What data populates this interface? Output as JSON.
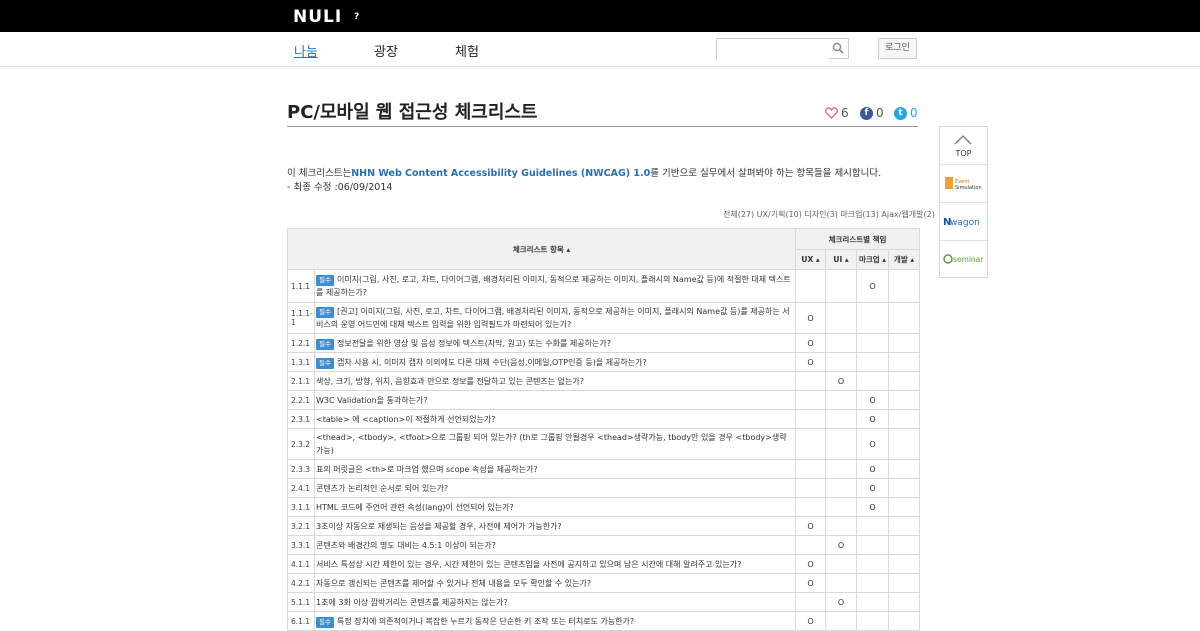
{
  "header": {
    "logo": "NULI",
    "logo_suffix": "?",
    "login_label": "로그인"
  },
  "search": {
    "placeholder": ""
  },
  "nav": {
    "items": [
      "나눔",
      "광장",
      "체험"
    ]
  },
  "page": {
    "title": "PC/모바일 웹 접근성 체크리스트",
    "likes": "6",
    "facebook_count": "0",
    "twitter_count": "0",
    "intro_prefix": "이 체크리스트는",
    "intro_link": "NHN Web Content Accessibility Guidelines (NWCAG) 1.0",
    "intro_suffix": "를 기반으로 실무에서 살펴봐야 하는 항목들을 제시합니다.",
    "last_modified": "- 최종 수정 :06/09/2014",
    "filter": "전체(27) UX/기획(10) 디자인(3) 마크업(13) Ajax/웹개발(2)"
  },
  "table": {
    "header_item": "체크리스트 항목 ▴",
    "header_role": "체크리스트별 책임",
    "roles": [
      "UX ▴",
      "UI ▴",
      "마크업 ▴",
      "개발 ▴"
    ],
    "badge_label": "필수",
    "rows": [
      {
        "num": "1.1.1",
        "badge": true,
        "text": "이미지(그림, 사진, 로고, 차트, 다이어그램, 배경처리된 이미지, 동적으로 제공하는 이미지, 플래시의 Name값 등)에 적절한 대체 텍스트를 제공하는가?",
        "marks": [
          "",
          "",
          "O",
          ""
        ]
      },
      {
        "num": "1.1.1-1",
        "badge": true,
        "text": "[권고] 이미지(그림, 사진, 로고, 차트, 다이어그램, 배경처리된 이미지, 동적으로 제공하는 이미지, 플래시의 Name값 등)를 제공하는 서비스의 운영 어드민에 대체 텍스트 입력을 위한 입력필드가 마련되어 있는가?",
        "marks": [
          "O",
          "",
          "",
          ""
        ]
      },
      {
        "num": "1.2.1",
        "badge": true,
        "text": "정보전달을 위한 영상 및 음성 정보에 텍스트(자막, 원고) 또는 수화를 제공하는가?",
        "marks": [
          "O",
          "",
          "",
          ""
        ]
      },
      {
        "num": "1.3.1",
        "badge": true,
        "text": "캡차 사용 시, 이미지 캡차 이외에도 다른 대체 수단(음성,이메일,OTP인증 등)을 제공하는가?",
        "marks": [
          "O",
          "",
          "",
          ""
        ]
      },
      {
        "num": "2.1.1",
        "badge": false,
        "text": "색상, 크기, 방향, 위치, 음향효과 만으로 정보를 전달하고 있는 콘텐츠는 없는가?",
        "marks": [
          "",
          "O",
          "",
          ""
        ]
      },
      {
        "num": "2.2.1",
        "badge": false,
        "text": "W3C Validation을 통과하는가?",
        "marks": [
          "",
          "",
          "O",
          ""
        ]
      },
      {
        "num": "2.3.1",
        "badge": false,
        "text": "<table> 에 <caption>이 적절하게 선언되었는가?",
        "marks": [
          "",
          "",
          "O",
          ""
        ]
      },
      {
        "num": "2.3.2",
        "badge": false,
        "text": "<thead>, <tbody>, <tfoot>으로 그룹핑 되어 있는가? (th로 그룹핑 안될경우 <thead>생략가능, tbody만 있을 경우 <tbody>생략 가능)",
        "marks": [
          "",
          "",
          "O",
          ""
        ]
      },
      {
        "num": "2.3.3",
        "badge": false,
        "text": "표의 머릿글은 <th>로 마크업 했으며 scope 속성을 제공하는가?",
        "marks": [
          "",
          "",
          "O",
          ""
        ]
      },
      {
        "num": "2.4.1",
        "badge": false,
        "text": "콘텐츠가 논리적인 순서로 되어 있는가?",
        "marks": [
          "",
          "",
          "O",
          ""
        ]
      },
      {
        "num": "3.1.1",
        "badge": false,
        "text": "HTML 코드에 주언어 관련 속성(lang)이 선언되어 있는가?",
        "marks": [
          "",
          "",
          "O",
          ""
        ]
      },
      {
        "num": "3.2.1",
        "badge": false,
        "text": "3초이상 자동으로 재생되는 음성을 제공할 경우, 사전에 제어가 가능한가?",
        "marks": [
          "O",
          "",
          "",
          ""
        ]
      },
      {
        "num": "3.3.1",
        "badge": false,
        "text": "콘텐츠와 배경간의 명도 대비는 4.5:1 이상이 되는가?",
        "marks": [
          "",
          "O",
          "",
          ""
        ]
      },
      {
        "num": "4.1.1",
        "badge": false,
        "text": "서비스 특성상 시간 제한이 있는 경우, 시간 제한이 있는 콘텐츠임을 사전에 공지하고 있으며 남은 시간에 대해 알려주고 있는가?",
        "marks": [
          "O",
          "",
          "",
          ""
        ]
      },
      {
        "num": "4.2.1",
        "badge": false,
        "text": "자동으로 갱신되는 콘텐츠를 제어할 수 있거나 전체 내용을 모두 확인할 수 있는가?",
        "marks": [
          "O",
          "",
          "",
          ""
        ]
      },
      {
        "num": "5.1.1",
        "badge": false,
        "text": "1초에 3회 이상 깜박거리는 콘텐츠를 제공하지는 않는가?",
        "marks": [
          "",
          "O",
          "",
          ""
        ]
      },
      {
        "num": "6.1.1",
        "badge": true,
        "text": "특정 장치에 의존적이거나 복잡한 누르기 동작은 단순한 키 조작 또는 터치로도 가능한가?",
        "marks": [
          "O",
          "",
          "",
          ""
        ]
      }
    ]
  },
  "side": {
    "top_label": "TOP",
    "banners": [
      "Event Simulation",
      "wagon",
      "seminar"
    ]
  },
  "colors": {
    "accent": "#2a7ab8",
    "badge": "#3c8ed0",
    "heart": "#e06a7a",
    "facebook": "#3b5998",
    "twitter": "#2aa3e0"
  }
}
